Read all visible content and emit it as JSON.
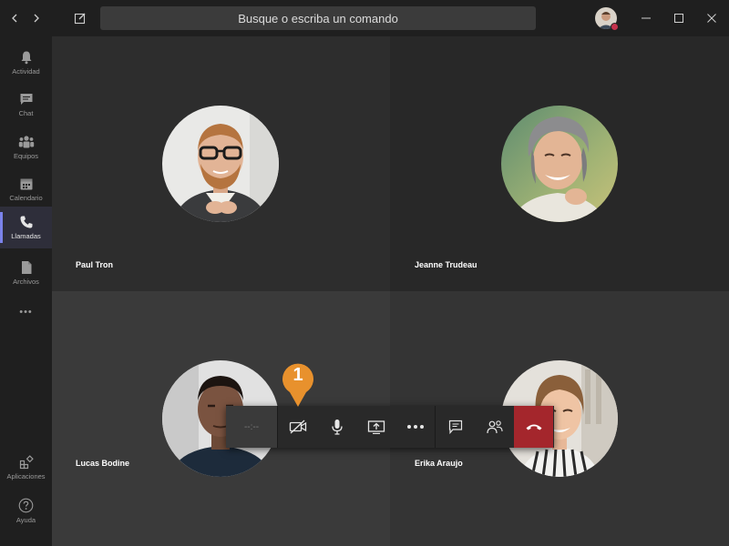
{
  "search": {
    "placeholder": "Busque o escriba un comando"
  },
  "rail": {
    "items": [
      {
        "label": "Actividad",
        "icon": "bell-icon"
      },
      {
        "label": "Chat",
        "icon": "chat-icon"
      },
      {
        "label": "Equipos",
        "icon": "teams-icon"
      },
      {
        "label": "Calendario",
        "icon": "calendar-icon"
      },
      {
        "label": "Llamadas",
        "icon": "phone-icon",
        "active": true
      },
      {
        "label": "Archivos",
        "icon": "file-icon"
      }
    ],
    "more": "•••",
    "apps_label": "Aplicaciones",
    "help_label": "Ayuda"
  },
  "participants": [
    {
      "name": "Paul Tron"
    },
    {
      "name": "Jeanne Trudeau"
    },
    {
      "name": "Lucas Bodine"
    },
    {
      "name": "Erika Araujo"
    }
  ],
  "callbar": {
    "timer": "--:--"
  },
  "callout": {
    "number": "1"
  },
  "colors": {
    "accent": "#7b83eb",
    "hangup": "#a4262c",
    "callout": "#e8912d",
    "status_busy": "#c4314b"
  }
}
